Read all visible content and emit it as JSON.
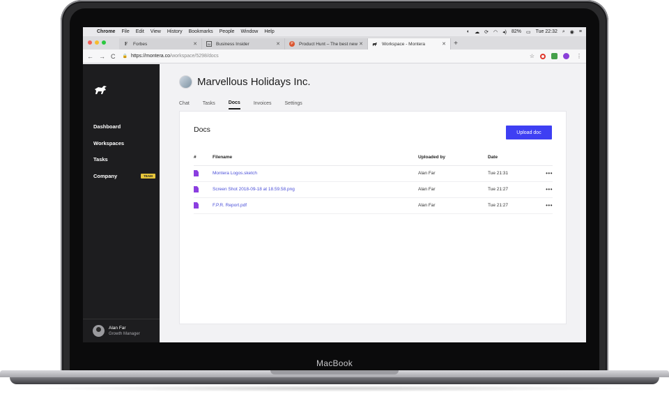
{
  "device": {
    "label": "MacBook"
  },
  "menubar": {
    "apple": "",
    "items": [
      "Chrome",
      "File",
      "Edit",
      "View",
      "History",
      "Bookmarks",
      "People",
      "Window",
      "Help"
    ],
    "battery": "82%",
    "clock": "Tue 22:32"
  },
  "browser": {
    "tabs": [
      {
        "title": "Forbes",
        "icon": "F"
      },
      {
        "title": "Business Insider",
        "icon": "BI"
      },
      {
        "title": "Product Hunt – The best new p",
        "icon": "P"
      },
      {
        "title": "Workspace - Montera",
        "icon": "bull"
      }
    ],
    "address": {
      "host": "https://montera.co",
      "path": "/workspace/5298/docs"
    }
  },
  "sidebar": {
    "items": [
      {
        "label": "Dashboard"
      },
      {
        "label": "Workspaces"
      },
      {
        "label": "Tasks"
      },
      {
        "label": "Company",
        "badge": "TEAM"
      }
    ],
    "user": {
      "name": "Alan Far",
      "role": "Growth Manager"
    }
  },
  "main": {
    "company": "Marvellous Holidays Inc.",
    "tabs": [
      "Chat",
      "Tasks",
      "Docs",
      "Invoices",
      "Settings"
    ],
    "active_tab": "Docs",
    "card": {
      "title": "Docs",
      "upload_label": "Upload doc",
      "columns": [
        "#",
        "Filename",
        "Uploaded by",
        "Date"
      ],
      "rows": [
        {
          "filename": "Montera Logos.sketch",
          "uploaded_by": "Alan Far",
          "date": "Tue 21:31",
          "more": "•••"
        },
        {
          "filename": "Screen Shot 2018-09-18 at 18.59.58.png",
          "uploaded_by": "Alan Far",
          "date": "Tue 21:27",
          "more": "•••"
        },
        {
          "filename": "F.P.R. Report.pdf",
          "uploaded_by": "Alan Far",
          "date": "Tue 21:27",
          "more": "•••"
        }
      ]
    }
  },
  "colors": {
    "accent": "#3e3ff3",
    "sidebar": "#1d1d1f",
    "file_icon": "#8b3ee0",
    "badge": "#e6c53b",
    "link": "#4a4fd8"
  }
}
